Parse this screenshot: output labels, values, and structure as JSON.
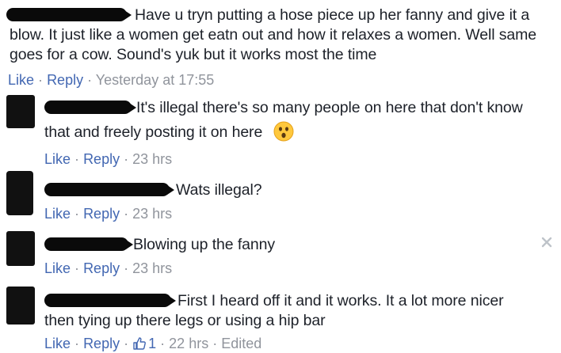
{
  "comments": [
    {
      "text": "Have u tryn putting a hose piece up her fanny and give it a blow. It just like a women get eatn out and how it relaxes a women. Well same goes for a cow. Sound's yuk but it works most the time",
      "like": "Like",
      "reply": "Reply",
      "time": "Yesterday at 17:55"
    },
    {
      "text_line1": "It's illegal there's so many people on here that don't know",
      "text_line2": "that and freely posting it on here",
      "like": "Like",
      "reply": "Reply",
      "time": "23 hrs"
    },
    {
      "text": "Wats illegal?",
      "like": "Like",
      "reply": "Reply",
      "time": "23 hrs"
    },
    {
      "text": "Blowing up the fanny",
      "like": "Like",
      "reply": "Reply",
      "time": "23 hrs"
    },
    {
      "text_line1": "First I heard off it and it works. It a lot more nicer",
      "text_line2": "then tying up there legs or using a hip bar",
      "like": "Like",
      "reply": "Reply",
      "like_count": "1",
      "time": "22 hrs",
      "edited": "Edited"
    }
  ],
  "separator": "·",
  "colors": {
    "link": "#4267b2",
    "meta": "#90949c",
    "text": "#1d2129"
  },
  "icons": {
    "emoji": "astonished-face-icon",
    "close": "close-icon",
    "thumb": "thumbs-up-icon"
  }
}
